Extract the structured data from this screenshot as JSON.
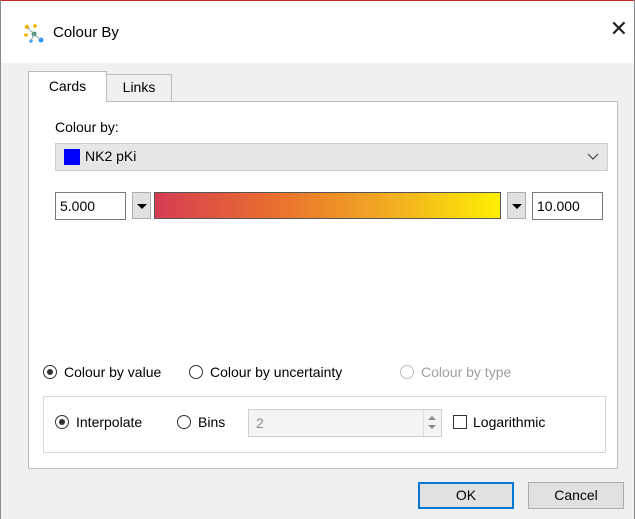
{
  "window": {
    "title": "Colour By",
    "close_glyph": "✕"
  },
  "tabs": [
    {
      "label": "Cards",
      "active": true
    },
    {
      "label": "Links",
      "active": false
    }
  ],
  "colour_by": {
    "label": "Colour by:",
    "selected": "NK2 pKi",
    "swatch_color": "#0000ff"
  },
  "range": {
    "min": "5.000",
    "max": "10.000",
    "gradient_colors": [
      "#d63c52",
      "#e9702e",
      "#f2b020",
      "#fdf003"
    ]
  },
  "mode_options": [
    {
      "label": "Colour by value",
      "checked": true,
      "enabled": true
    },
    {
      "label": "Colour by uncertainty",
      "checked": false,
      "enabled": true
    },
    {
      "label": "Colour by type",
      "checked": false,
      "enabled": false
    }
  ],
  "interpolation": {
    "interpolate_label": "Interpolate",
    "interpolate_checked": true,
    "bins_label": "Bins",
    "bins_checked": false,
    "bins_value": "2",
    "logarithmic_label": "Logarithmic",
    "logarithmic_checked": false
  },
  "buttons": {
    "ok": "OK",
    "cancel": "Cancel"
  },
  "icons": {
    "app": "sparkle-network-icon",
    "close": "close-icon",
    "dropdown": "chevron-down-icon"
  }
}
